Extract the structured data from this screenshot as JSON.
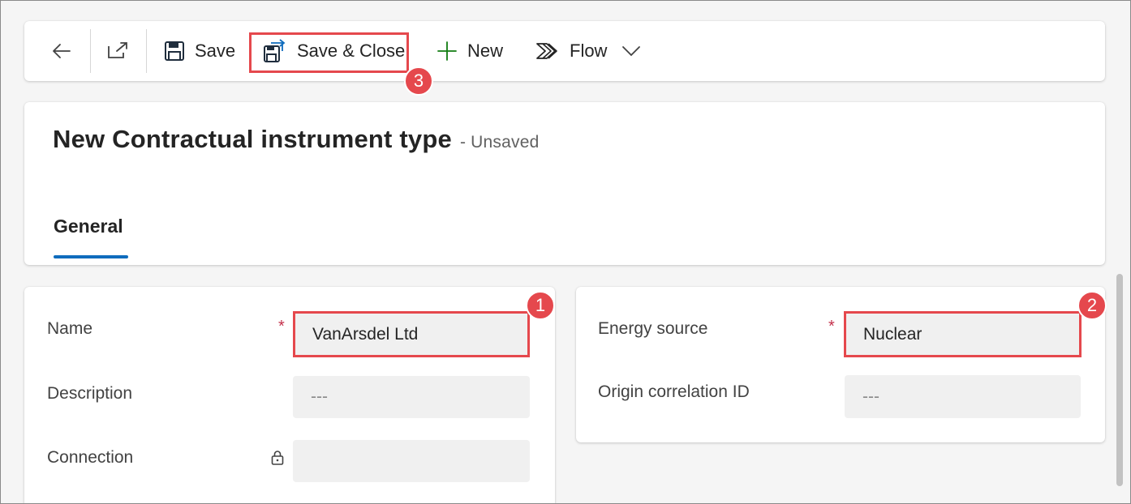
{
  "toolbar": {
    "back_icon": "arrow-left-icon",
    "popout_icon": "open-in-new-window-icon",
    "save_label": "Save",
    "save_close_label": "Save & Close",
    "new_label": "New",
    "flow_label": "Flow"
  },
  "header": {
    "title": "New Contractual instrument type",
    "status": "- Unsaved",
    "tabs": [
      {
        "label": "General"
      }
    ]
  },
  "form_left": {
    "name_label": "Name",
    "name_value": "VanArsdel Ltd",
    "description_label": "Description",
    "description_value": "---",
    "connection_label": "Connection",
    "connection_value": ""
  },
  "form_right": {
    "energy_source_label": "Energy source",
    "energy_source_value": "Nuclear",
    "origin_correlation_label": "Origin correlation ID",
    "origin_correlation_value": "---"
  },
  "annotations": {
    "badge_1": "1",
    "badge_2": "2",
    "badge_3": "3"
  },
  "colors": {
    "highlight": "#e5484d",
    "tab_accent": "#0f6cbd",
    "required": "#c4314b",
    "new_plus": "#107c10"
  }
}
